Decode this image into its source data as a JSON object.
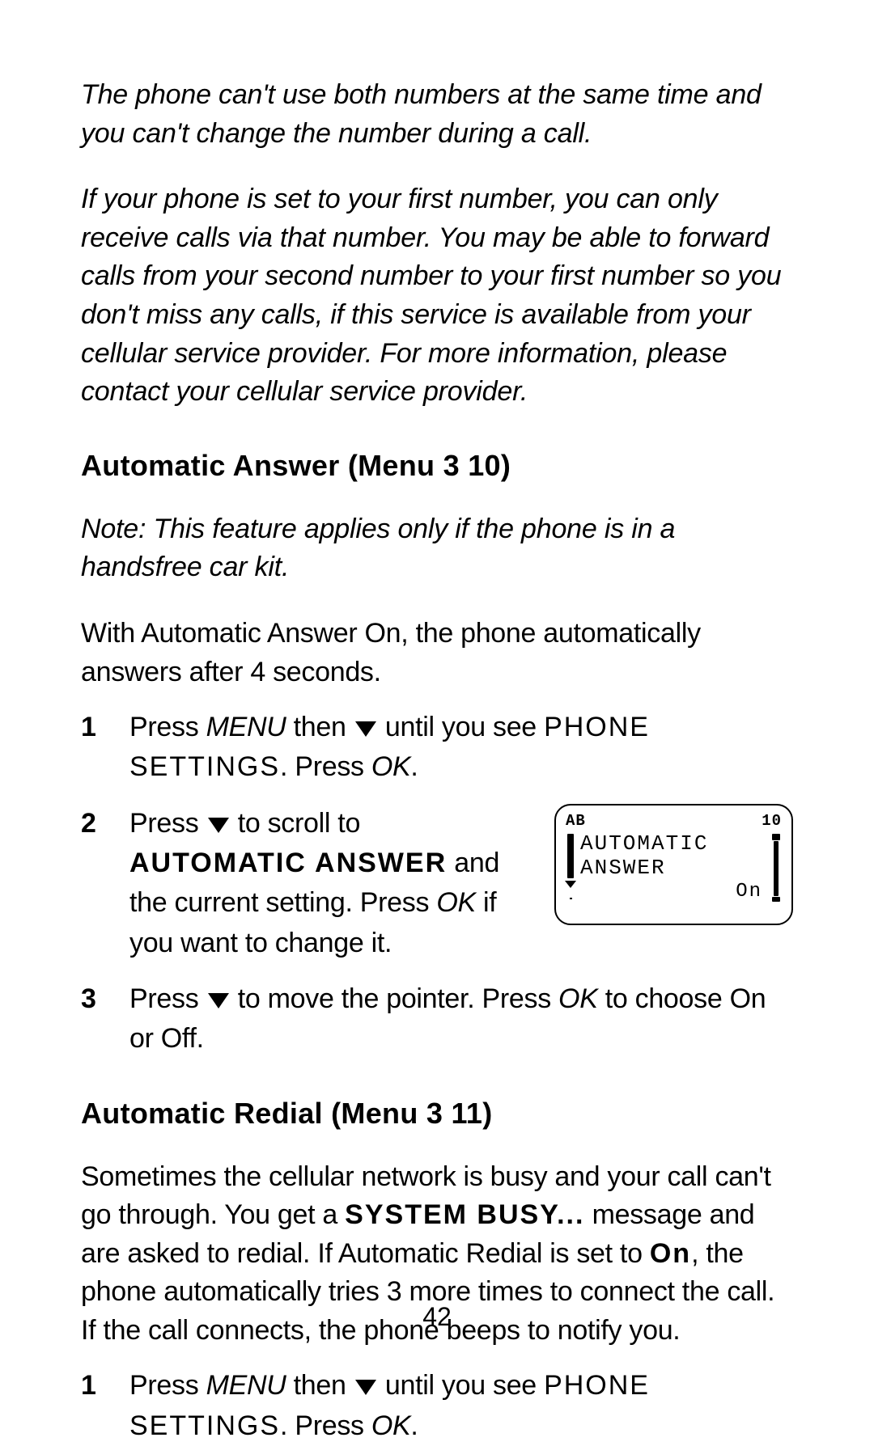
{
  "intro": {
    "p1": "The phone can't use both numbers at the same time and you can't change the number during a call.",
    "p2": "If your phone is set to your first number, you can only receive calls via that number. You may be able to forward calls from your second number to your first number so you don't miss any calls, if this service is available from your cellular service provider. For more information, please contact your cellular service provider."
  },
  "autoAnswer": {
    "heading": "Automatic Answer (Menu 3 10)",
    "note": "Note: This feature applies only if the phone is in a handsfree car kit.",
    "body": "With Automatic Answer On, the phone automatically answers after 4 seconds.",
    "step1": {
      "num": "1",
      "pre": "Press ",
      "menu": "MENU",
      "mid": " then ",
      "post": " until you see ",
      "disp": "PHONE SETTINGS",
      "per": ". Press ",
      "ok": "OK",
      "end": "."
    },
    "step2": {
      "num": "2",
      "pre": "Press ",
      "mid": " to scroll to ",
      "disp": "AUTOMATIC ANSWER",
      "post": " and the current setting. Press ",
      "ok": "OK",
      "end": " if you want to change it."
    },
    "step3": {
      "num": "3",
      "pre": "Press ",
      "mid": " to move the pointer. Press ",
      "ok": "OK",
      "end": " to choose On or Off."
    },
    "screen": {
      "ab": "AB",
      "ten": "10",
      "line1": "AUTOMATIC",
      "line2": "ANSWER",
      "on": "On"
    }
  },
  "autoRedial": {
    "heading": "Automatic Redial (Menu 3 11)",
    "body": {
      "a": "Sometimes the cellular network is busy and your call can't go through. You get a ",
      "busy": "SYSTEM BUSY...",
      "b": " message and are asked to redial. If Automatic Redial is set to ",
      "on": "On",
      "c": ", the phone automatically tries 3 more times to connect the call. If the call connects, the phone beeps to notify you."
    },
    "step1": {
      "num": "1",
      "pre": "Press ",
      "menu": "MENU",
      "mid": " then ",
      "post": " until you see ",
      "disp": "PHONE SETTINGS",
      "per": ". Press ",
      "ok": "OK",
      "end": "."
    }
  },
  "pageNumber": "42"
}
